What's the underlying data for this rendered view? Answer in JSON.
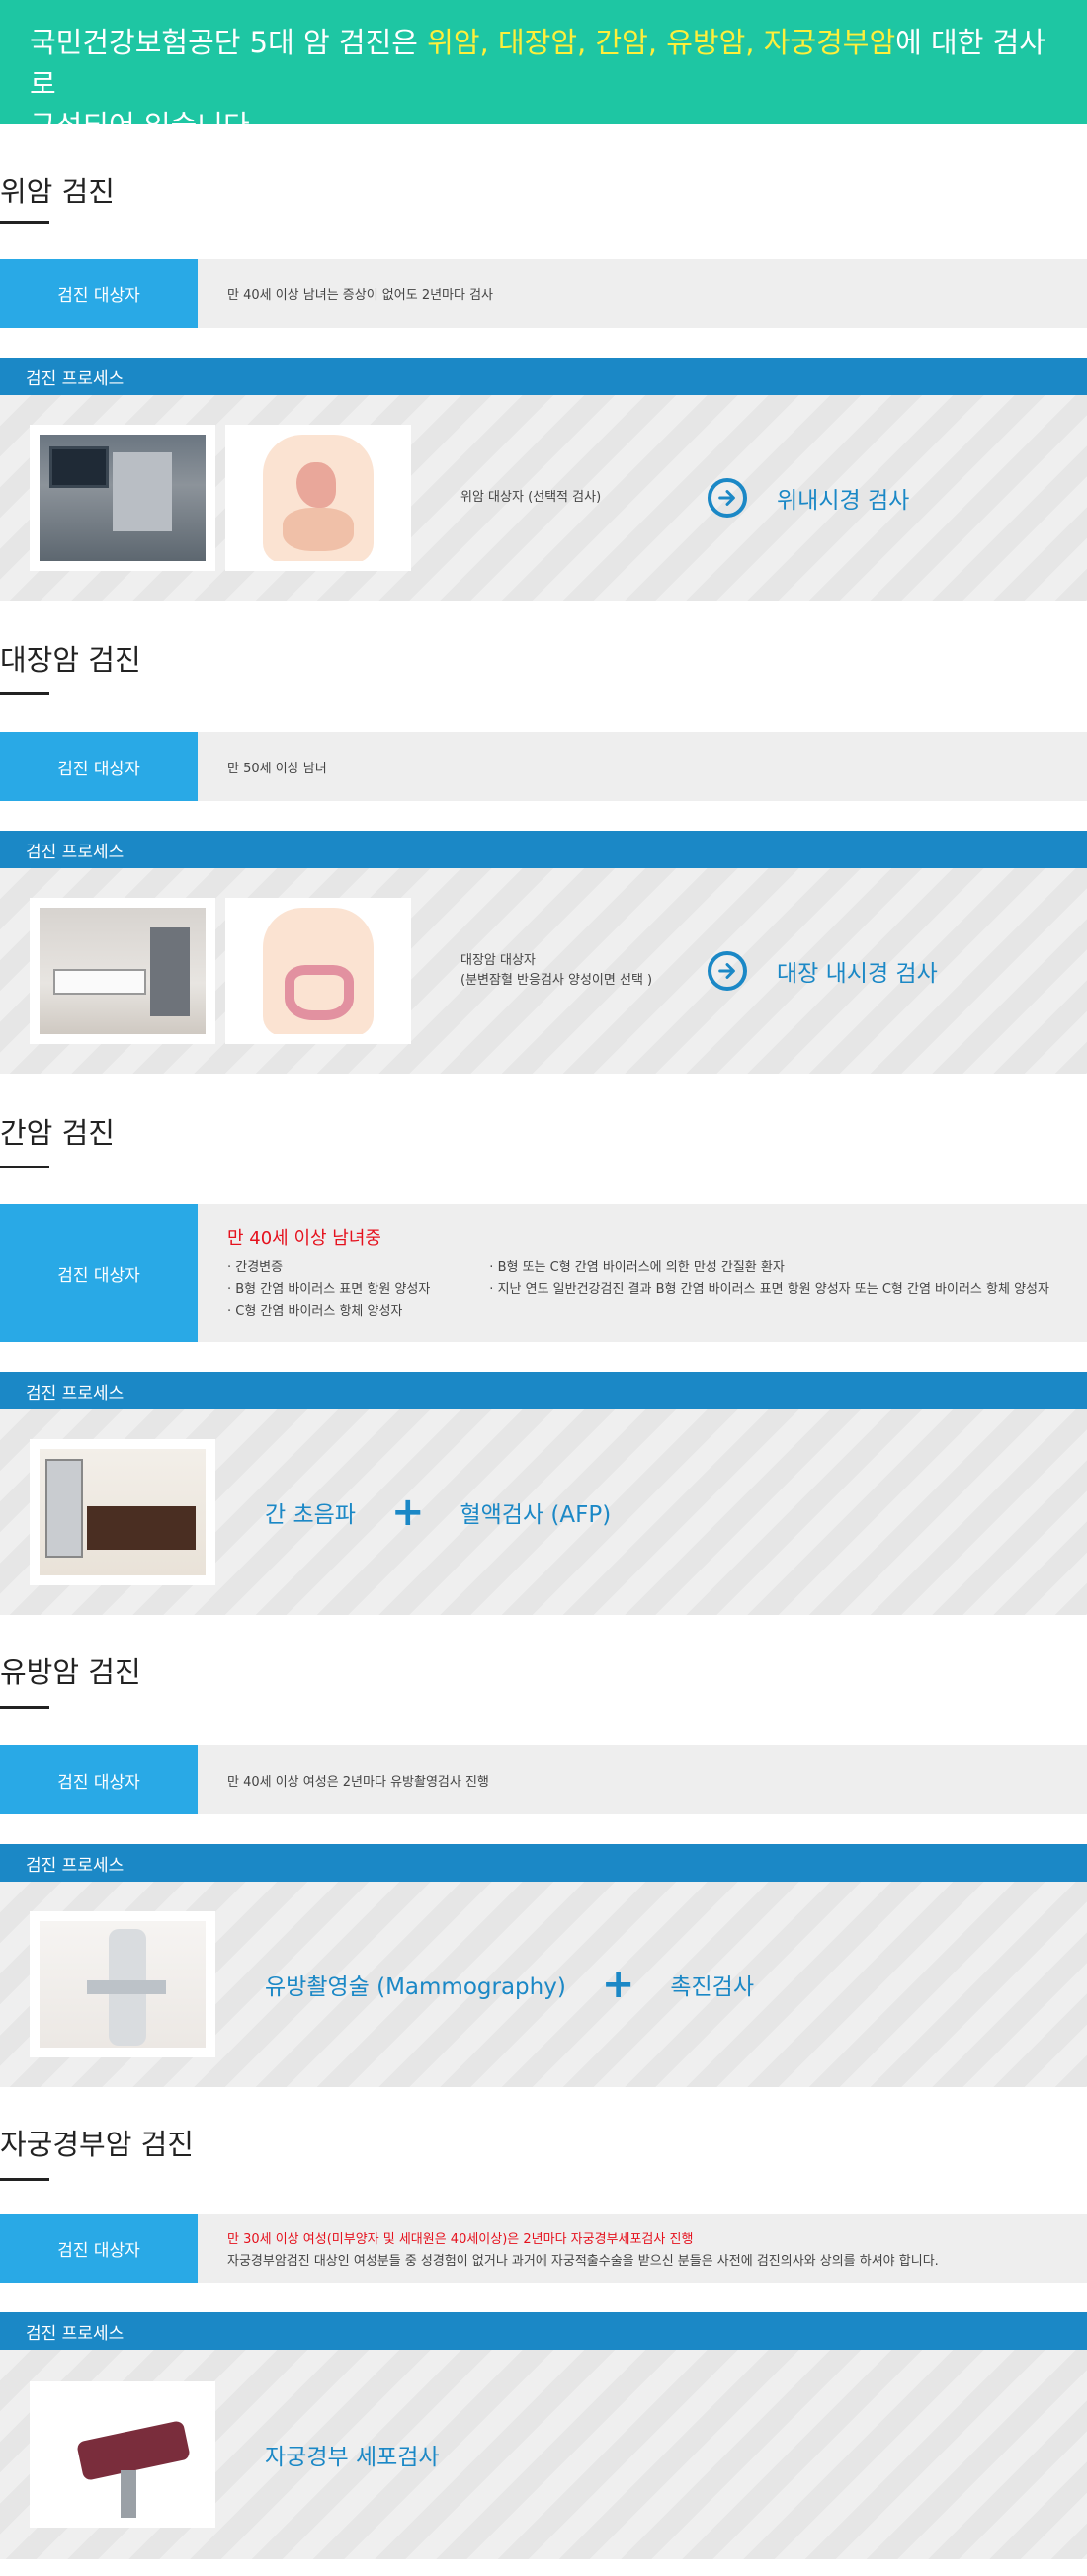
{
  "banner": {
    "prefix": "국민건강보험공단 5대 암 검진은 ",
    "highlight": "위암, 대장암, 간암, 유방암, 자궁경부암",
    "suffix_line1": "에 대한 검사로",
    "line2": "구성되어 있습니다."
  },
  "common": {
    "target_label": "검진 대상자",
    "process_label": "검진 프로세스"
  },
  "stomach": {
    "title": "위암 검진",
    "target": "만 40세 이상 남녀는 증상이 없어도 2년마다 검사",
    "note": "위암 대상자 (선택적 검사)",
    "result": "위내시경 검사"
  },
  "colon": {
    "title": "대장암 검진",
    "target": "만 50세 이상 남녀",
    "note_line1": "대장암 대상자",
    "note_line2": "(분변잠혈 반응검사 양성이면 선택 )",
    "result": "대장 내시경 검사"
  },
  "liver": {
    "title": "간암 검진",
    "target_heading": "만 40세 이상 남녀중",
    "list_left": [
      "간경변증",
      "B형 간염 바이러스 표면 항원 양성자",
      "C형 간염 바이러스 항체 양성자"
    ],
    "list_right": [
      "B형 또는 C형 간염 바이러스에 의한 만성 간질환 환자",
      "지난 연도 일반건강검진 결과 B형 간염 바이러스 표면 항원 양성자 또는 C형 간염 바이러스 항체 양성자"
    ],
    "proc1": "간 초음파",
    "proc2": "혈액검사 (AFP)"
  },
  "breast": {
    "title": "유방암 검진",
    "target": "만 40세 이상 여성은 2년마다 유방촬영검사 진행",
    "proc1": "유방촬영술 (Mammography)",
    "proc2": "촉진검사"
  },
  "cervix": {
    "title": "자궁경부암 검진",
    "target_red": "만 30세 이상 여성(미부양자 및 세대원은 40세이상)은 2년마다 자궁경부세포검사 진행",
    "target_line2": "자궁경부암검진 대상인 여성분들 중 성경험이 없거나 과거에 자궁적출수술을 받으신 분들은 사전에 검진의사와 상의를 하셔야 합니다.",
    "proc1": "자궁경부 세포검사"
  },
  "colors": {
    "banner": "#1ec6a3",
    "highlight": "#ffef3a",
    "target_label": "#29a9e6",
    "process_head": "#1b88c6",
    "accent_text": "#1b88c6",
    "warning_red": "#e5111d"
  }
}
